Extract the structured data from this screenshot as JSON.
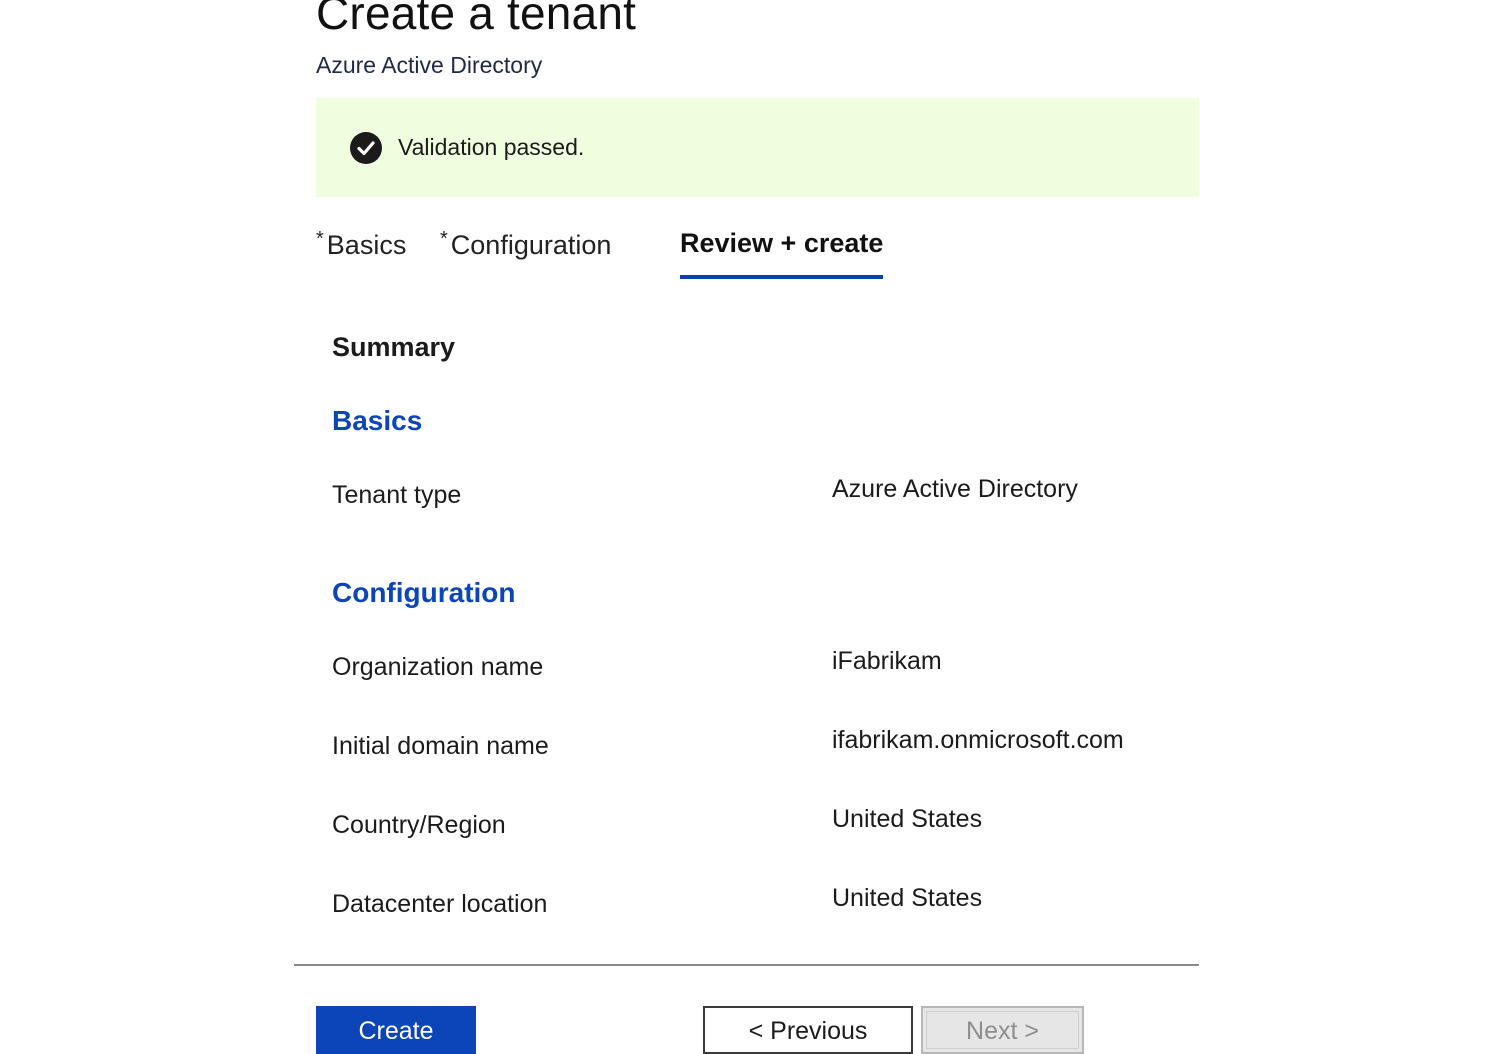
{
  "header": {
    "title": "Create a tenant",
    "subtitle": "Azure Active Directory"
  },
  "banner": {
    "icon": "check-circle-icon",
    "text": "Validation passed.",
    "background": "#eefede"
  },
  "tabs": [
    {
      "label": "Basics",
      "required_marker": "*",
      "active": false
    },
    {
      "label": "Configuration",
      "required_marker": "*",
      "active": false
    },
    {
      "label": "Review + create",
      "required_marker": "",
      "active": true
    }
  ],
  "summary": {
    "heading": "Summary",
    "sections": [
      {
        "heading": "Basics",
        "rows": [
          {
            "label": "Tenant type",
            "value": "Azure Active Directory"
          }
        ]
      },
      {
        "heading": "Configuration",
        "rows": [
          {
            "label": "Organization name",
            "value": "iFabrikam"
          },
          {
            "label": "Initial domain name",
            "value": "ifabrikam.onmicrosoft.com"
          },
          {
            "label": "Country/Region",
            "value": "United States"
          },
          {
            "label": "Datacenter location",
            "value": "United States"
          }
        ]
      }
    ]
  },
  "footer": {
    "create_label": "Create",
    "previous_label": "< Previous",
    "next_label": "Next >"
  },
  "colors": {
    "accent": "#0b45b7",
    "tab_underline": "#0a3fae"
  }
}
